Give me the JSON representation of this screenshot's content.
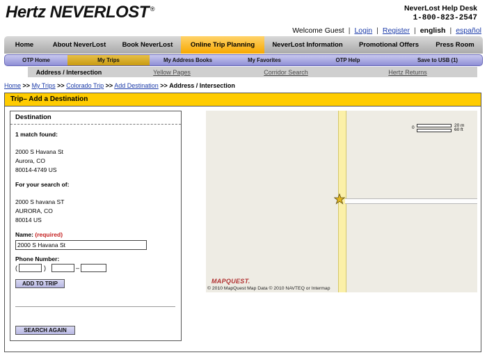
{
  "header": {
    "logo_text": "Hertz NEVERLOST",
    "logo_reg": "®",
    "help_title": "NeverLost Help Desk",
    "help_phone": "1-800-823-2547",
    "welcome": "Welcome Guest",
    "login": "Login",
    "register": "Register",
    "lang_current": "english",
    "lang_other": "español",
    "sep": "|"
  },
  "main_nav": [
    {
      "label": "Home"
    },
    {
      "label": "About NeverLost"
    },
    {
      "label": "Book NeverLost"
    },
    {
      "label": "Online Trip Planning"
    },
    {
      "label": "NeverLost Information"
    },
    {
      "label": "Promotional Offers"
    },
    {
      "label": "Press Room"
    }
  ],
  "sub_nav": [
    {
      "label": "OTP Home"
    },
    {
      "label": "My Trips"
    },
    {
      "label": "My Address Books"
    },
    {
      "label": "My Favorites"
    },
    {
      "label": "OTP Help"
    },
    {
      "label": "Save to USB (1)"
    }
  ],
  "third_nav": [
    {
      "label": "Address / Intersection"
    },
    {
      "label": "Yellow Pages"
    },
    {
      "label": "Corridor Search"
    },
    {
      "label": "Hertz Returns"
    }
  ],
  "breadcrumb": {
    "home": "Home",
    "my_trips": "My Trips",
    "trip": "Colorado Trip",
    "add_dest": "Add Destination",
    "current": "Address / Intersection",
    "sep": ">>"
  },
  "panel": {
    "title": "Trip– Add a Destination"
  },
  "destination": {
    "title": "Destination",
    "match": "1 match found:",
    "result_line1": "2000 S Havana St",
    "result_line2": "Aurora, CO",
    "result_line3": "80014-4749 US",
    "search_label": "For your search of:",
    "search_line1": "2000 S havana ST",
    "search_line2": "AURORA, CO",
    "search_line3": "80014 US",
    "name_label": "Name:",
    "required": "(required)",
    "name_value": "2000 S Havana St",
    "phone_label": "Phone Number:",
    "paren_open": "(",
    "paren_close": ")",
    "dash": "–",
    "add_button": "ADD TO TRIP",
    "search_again": "SEARCH AGAIN"
  },
  "map": {
    "scale_zero": "0",
    "scale_m": "20 m",
    "scale_ft": "60 ft",
    "brand": "MAPQUEST.",
    "copyright": "© 2010 MapQuest Map Data  © 2010 NAVTEQ  or Intermap"
  }
}
